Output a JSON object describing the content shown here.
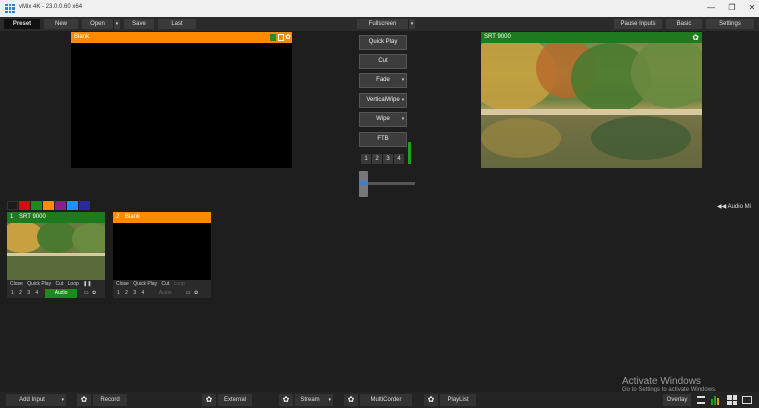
{
  "window": {
    "title": "vMix 4K - 23.0.0.60 x64",
    "minimize": "—",
    "restore": "❐",
    "close": "✕"
  },
  "toolbar": {
    "preset": "Preset",
    "new": "New",
    "open": "Open",
    "save": "Save",
    "last": "Last",
    "fullscreen": "Fullscreen",
    "pause_inputs": "Pause Inputs",
    "basic": "Basic",
    "settings": "Settings",
    "caret": "▾"
  },
  "preview": {
    "title": "Blank",
    "header_color": "#ff8a00"
  },
  "output": {
    "title": "SRT 9000",
    "header_color": "#1e7a1e",
    "gear": "✿"
  },
  "transitions": {
    "quick_play": "Quick Play",
    "cut": "Cut",
    "fade": "Fade",
    "vertical_wipe": "VerticalWipe",
    "wipe": "Wipe",
    "ftb": "FTB",
    "numbers": [
      "1",
      "2",
      "3",
      "4"
    ]
  },
  "swatches": [
    "#d01010",
    "#1e8a1e",
    "#ff8c00",
    "#8a1e8a",
    "#1e90ff",
    "#2a2aa0"
  ],
  "audio_mixer": {
    "label": "Audio Mi",
    "icon": "◀◀"
  },
  "inputs": [
    {
      "number": "1",
      "title": "SRT 9000",
      "header_color": "#1e7a1e",
      "controls": [
        "Close",
        "Quick Play",
        "Cut",
        "Loop",
        "❚❚"
      ],
      "nums": [
        "1",
        "2",
        "3",
        "4"
      ],
      "audio": "Audio"
    },
    {
      "number": "2",
      "title": "Blank",
      "header_color": "#ff8a00",
      "controls": [
        "Close",
        "Quick Play",
        "Cut",
        "Loop"
      ],
      "nums": [
        "1",
        "2",
        "3",
        "4"
      ],
      "audio": "Audio"
    }
  ],
  "bottom": {
    "add_input": "Add Input",
    "record": "Record",
    "external": "External",
    "stream": "Stream",
    "multicorder": "MultiCorder",
    "playlist": "PlayList",
    "overlay": "Overlay"
  },
  "watermark": {
    "line1": "Activate Windows",
    "line2": "Go to Settings to activate Windows."
  }
}
